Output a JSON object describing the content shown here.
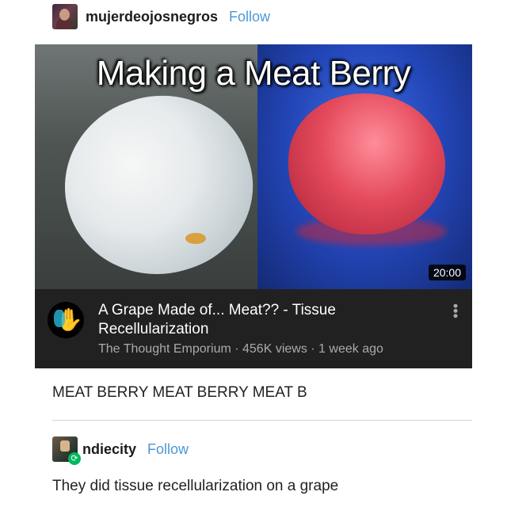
{
  "post1": {
    "username": "mujerdeojosnegros",
    "follow_label": "Follow",
    "video": {
      "thumbnail_title": "Making a Meat Berry",
      "duration": "20:00",
      "title": "A Grape Made of... Meat?? - Tissue Recellularization",
      "meta": "The Thought Emporium · 456K views · 1 week ago",
      "menu_icon": "more-vertical-icon"
    },
    "caption": "MEAT BERRY MEAT BERRY MEAT B"
  },
  "post2": {
    "username": "ndiecity",
    "follow_label": "Follow",
    "reblog_icon": "reblog-icon",
    "caption": "They did tissue recellularization on a grape"
  },
  "colors": {
    "follow": "#4e97d8",
    "card_bg": "#212121",
    "reblog_badge": "#00b85c"
  }
}
